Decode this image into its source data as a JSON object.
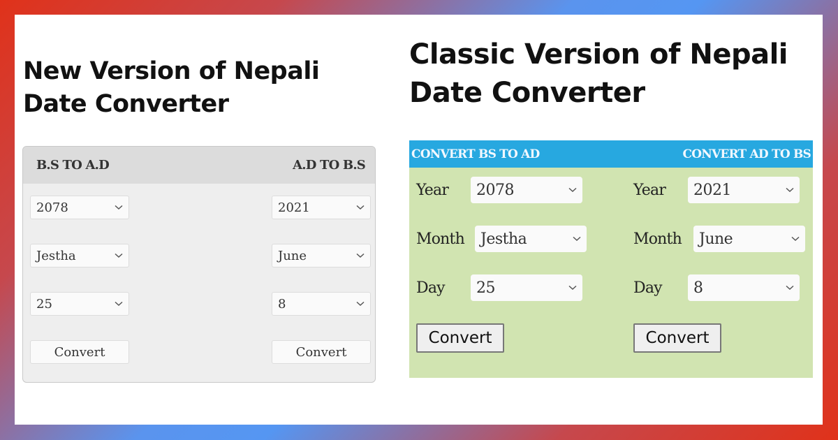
{
  "headings": {
    "new_version_line1": "New Version of Nepali",
    "new_version_line2": "Date Converter",
    "classic_version_line1": "Classic Version of Nepali",
    "classic_version_line2": "Date Converter"
  },
  "new_version": {
    "bs_to_ad_header": "B.S TO A.D",
    "ad_to_bs_header": "A.D TO B.S",
    "bs_to_ad": {
      "year": "2078",
      "month": "Jestha",
      "day": "25",
      "convert_label": "Convert"
    },
    "ad_to_bs": {
      "year": "2021",
      "month": "June",
      "day": "8",
      "convert_label": "Convert"
    }
  },
  "classic_version": {
    "bs_to_ad_header": "CONVERT BS TO AD",
    "ad_to_bs_header": "CONVERT AD TO BS",
    "labels": {
      "year": "Year",
      "month": "Month",
      "day": "Day"
    },
    "bs_to_ad": {
      "year": "2078",
      "month": "Jestha",
      "day": "25",
      "convert_label": "Convert"
    },
    "ad_to_bs": {
      "year": "2021",
      "month": "June",
      "day": "8",
      "convert_label": "Convert"
    }
  },
  "icons": {
    "dropdown": "chevron-down-icon"
  },
  "colors": {
    "classic_header_bg": "#27a8e0",
    "classic_body_bg": "#d1e4b1",
    "new_header_bg": "#dcdcdc",
    "new_body_bg": "#eeeeee"
  }
}
